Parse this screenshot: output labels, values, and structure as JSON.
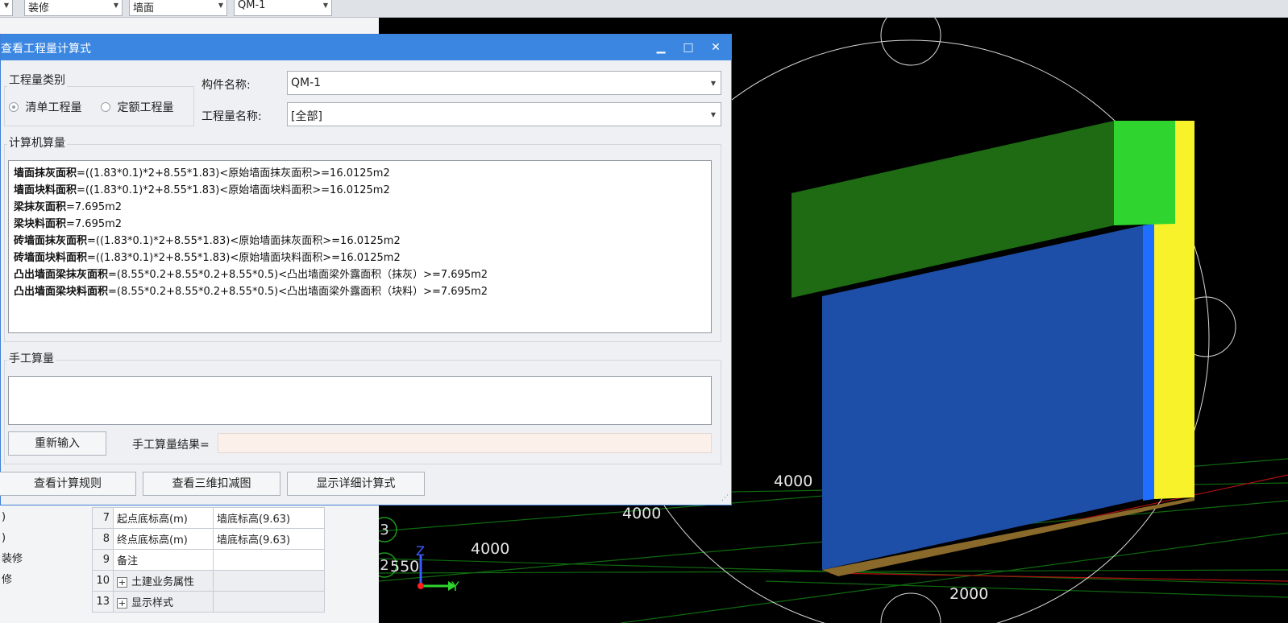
{
  "toolbar": {
    "combo1": "装修",
    "combo2": "墙面",
    "combo3": "QM-1"
  },
  "dialog": {
    "title": "查看工程量计算式",
    "category_label": "工程量类别",
    "radio_list": "清单工程量",
    "radio_quota": "定额工程量",
    "component_name_label": "构件名称:",
    "component_name_value": "QM-1",
    "quantity_name_label": "工程量名称:",
    "quantity_name_value": "[全部]",
    "computer_calc_label": "计算机算量",
    "formulas": [
      {
        "name": "墙面抹灰面积",
        "expr": "=((1.83*0.1)*2+8.55*1.83)<原始墙面抹灰面积>=16.0125m2"
      },
      {
        "name": "墙面块料面积",
        "expr": "=((1.83*0.1)*2+8.55*1.83)<原始墙面块料面积>=16.0125m2"
      },
      {
        "name": "梁抹灰面积",
        "expr": "=7.695m2"
      },
      {
        "name": "梁块料面积",
        "expr": "=7.695m2"
      },
      {
        "name": "砖墙面抹灰面积",
        "expr": "=((1.83*0.1)*2+8.55*1.83)<原始墙面抹灰面积>=16.0125m2"
      },
      {
        "name": "砖墙面块料面积",
        "expr": "=((1.83*0.1)*2+8.55*1.83)<原始墙面块料面积>=16.0125m2"
      },
      {
        "name": "凸出墙面梁抹灰面积",
        "expr": "=(8.55*0.2+8.55*0.2+8.55*0.5)<凸出墙面梁外露面积（抹灰）>=7.695m2"
      },
      {
        "name": "凸出墙面梁块料面积",
        "expr": "=(8.55*0.2+8.55*0.2+8.55*0.5)<凸出墙面梁外露面积（块料）>=7.695m2"
      }
    ],
    "manual_calc_label": "手工算量",
    "reinput_button": "重新输入",
    "manual_result_label": "手工算量结果=",
    "view_rules_button": "查看计算规则",
    "view_3d_button": "查看三维扣减图",
    "show_detail_button": "显示详细计算式"
  },
  "props": {
    "tree_items": [
      ")",
      ")",
      "装修",
      "修"
    ],
    "rows": [
      {
        "num": "7",
        "key": "起点底标高(m)",
        "value": "墙底标高(9.63)",
        "group": false
      },
      {
        "num": "8",
        "key": "终点底标高(m)",
        "value": "墙底标高(9.63)",
        "group": false
      },
      {
        "num": "9",
        "key": "备注",
        "value": "",
        "group": false
      },
      {
        "num": "10",
        "key": "土建业务属性",
        "value": "",
        "group": true
      },
      {
        "num": "13",
        "key": "显示样式",
        "value": "",
        "group": true
      }
    ]
  },
  "viewport": {
    "dims": [
      "4000",
      "4000",
      "4000",
      "2000",
      "550"
    ],
    "axis_labels": [
      "3",
      "2"
    ],
    "axis_z": "Z",
    "axis_y": "Y"
  },
  "colors": {
    "beam_dark": "#1e6b14",
    "beam_light": "#2fd42f",
    "wall_blue": "#1d4ea8",
    "wall_yellow": "#f7f22a",
    "title_bar": "#3a86e0"
  }
}
